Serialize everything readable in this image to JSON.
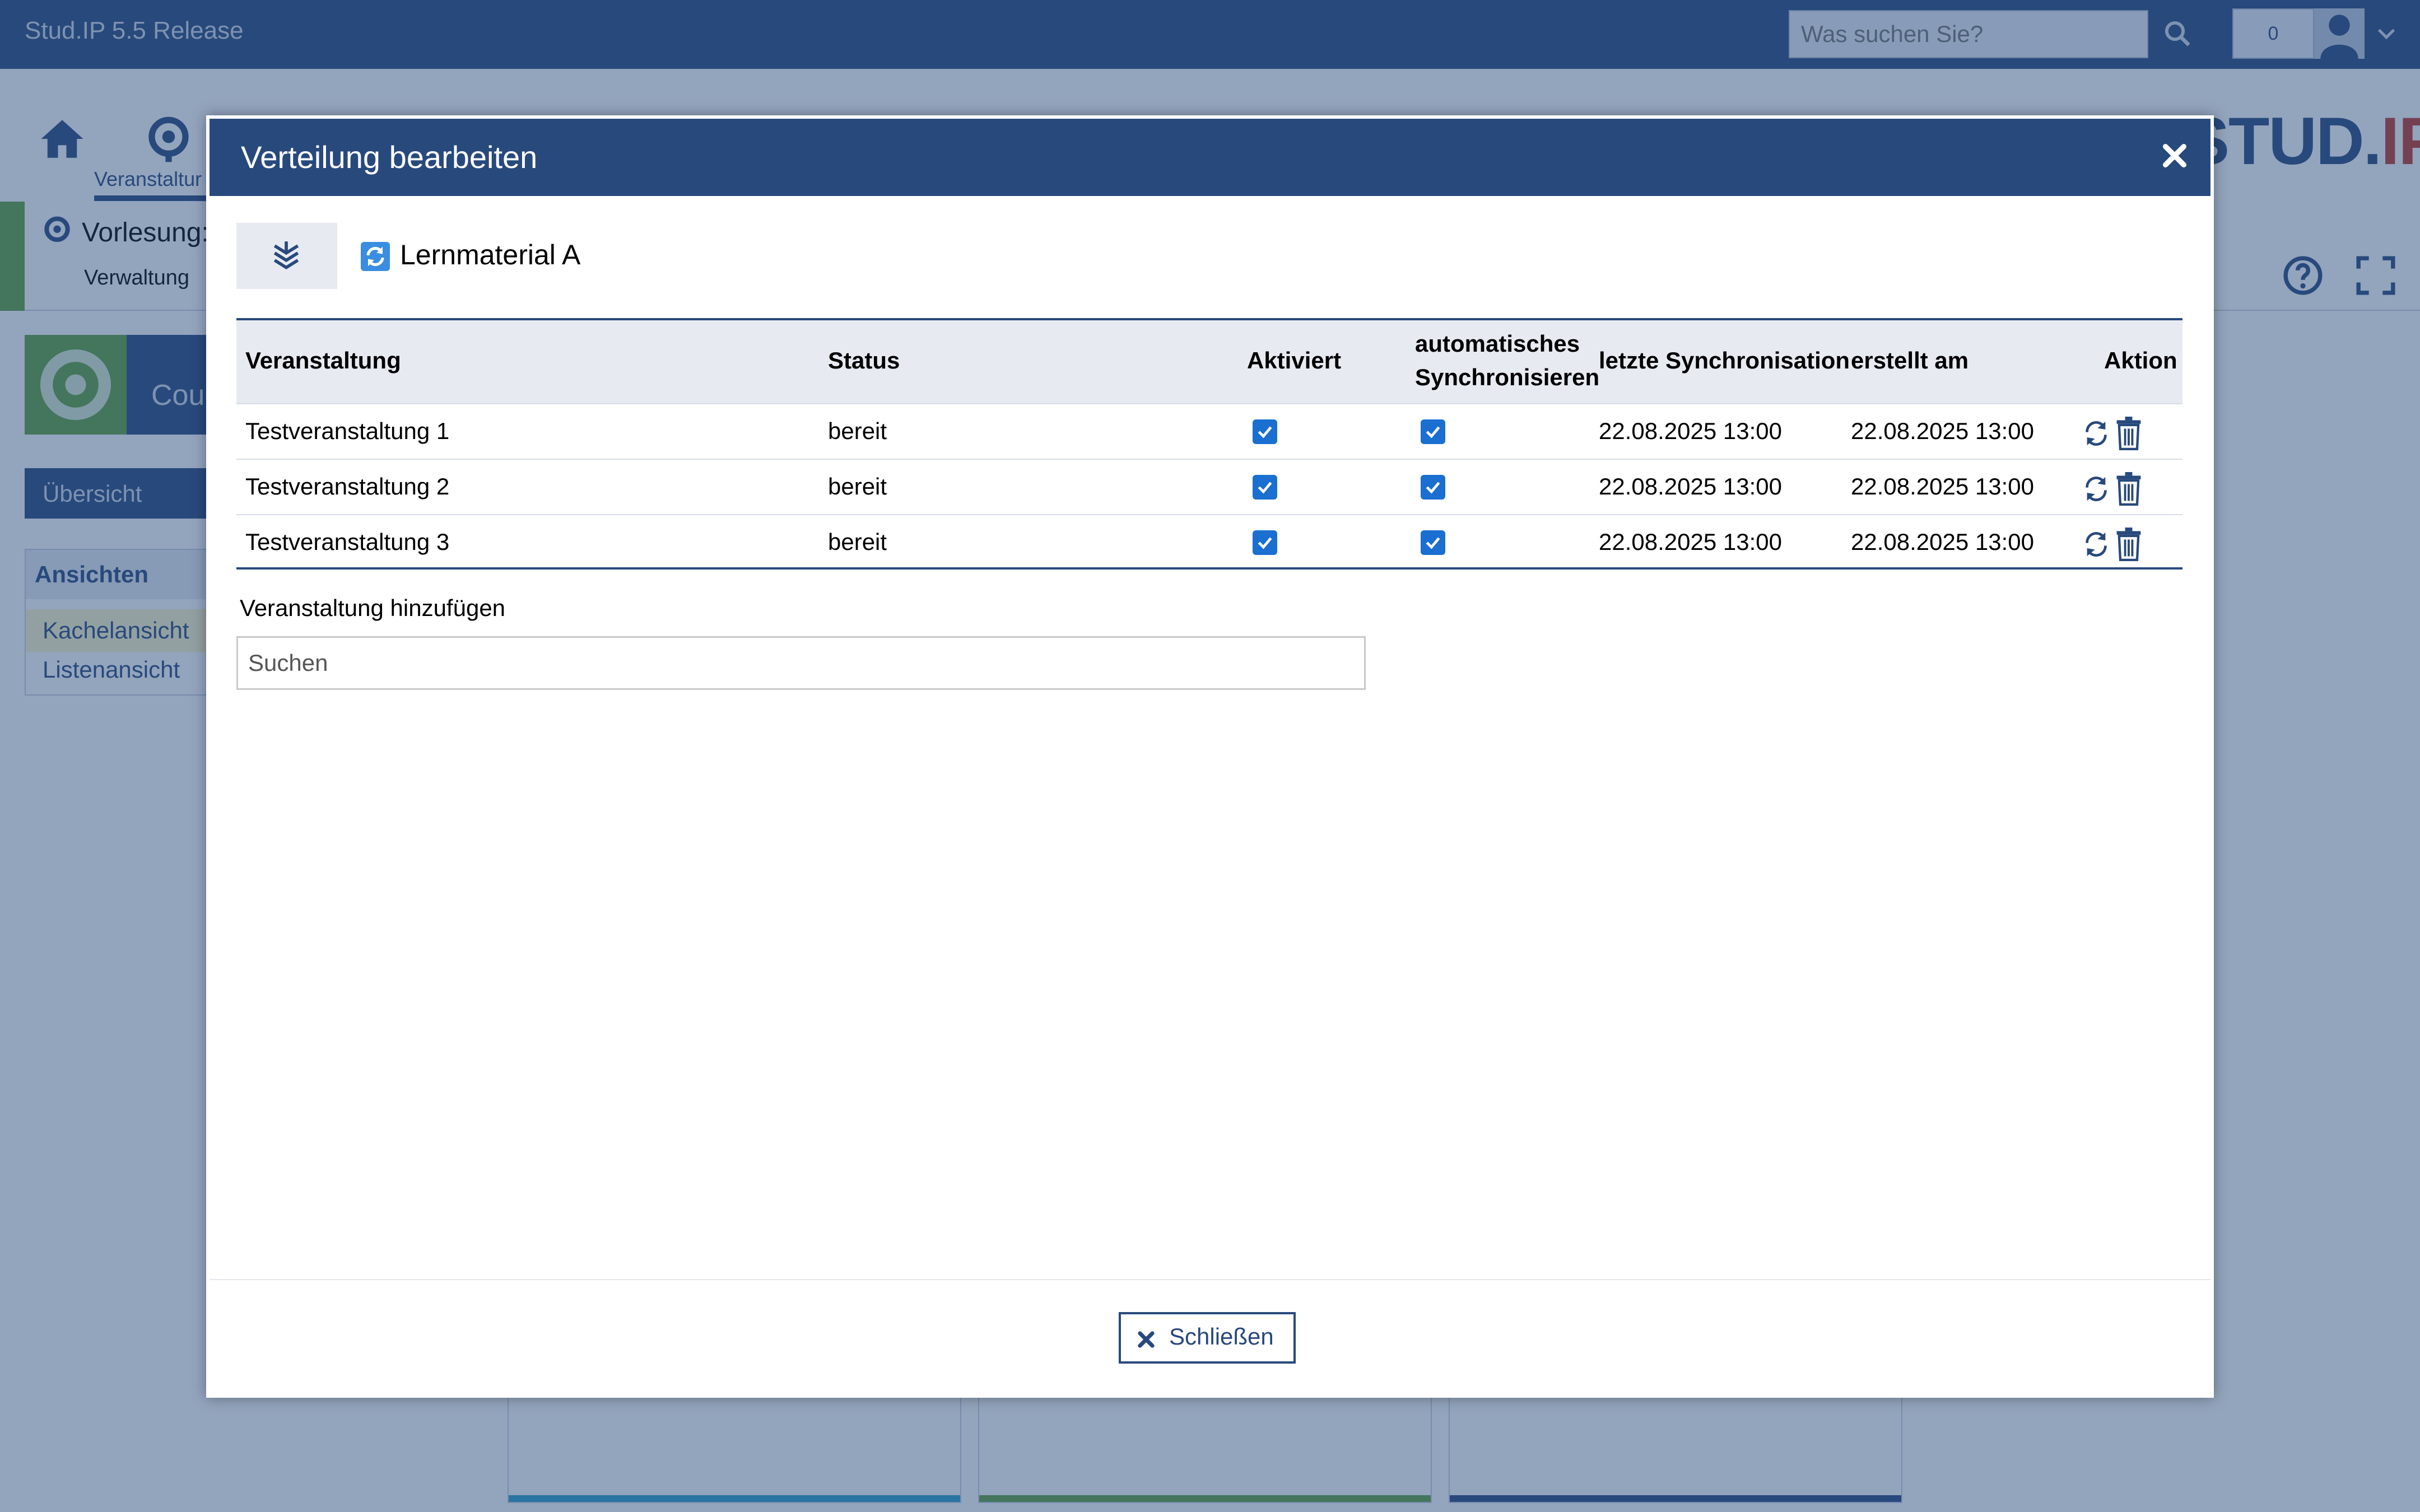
{
  "app": {
    "brand": "Stud.IP 5.5 Release",
    "search_placeholder": "Was suchen Sie?",
    "notification_count": "0",
    "logo_main": "STUD.",
    "logo_accent": "IP"
  },
  "nav": {
    "courses_label": "Veranstaltur"
  },
  "context": {
    "title": "Vorlesung:",
    "subtitle": "Verwaltung"
  },
  "sidebar": {
    "tile_text": "Cour",
    "overview": "Übersicht",
    "views_heading": "Ansichten",
    "views_items": [
      "Kachelansicht",
      "Listenansicht"
    ]
  },
  "dialog": {
    "title": "Verteilung bearbeiten",
    "material_name": "Lernmaterial A",
    "columns": {
      "course": "Veranstaltung",
      "status": "Status",
      "activated": "Aktiviert",
      "auto_sync_line1": "automatisches",
      "auto_sync_line2": "Synchronisieren",
      "last_sync": "letzte Synchronisation",
      "created": "erstellt am",
      "action": "Aktion"
    },
    "rows": [
      {
        "course": "Testveranstaltung 1",
        "status": "bereit",
        "activated": true,
        "auto_sync": true,
        "last_sync": "22.08.2025 13:00",
        "created": "22.08.2025 13:00"
      },
      {
        "course": "Testveranstaltung 2",
        "status": "bereit",
        "activated": true,
        "auto_sync": true,
        "last_sync": "22.08.2025 13:00",
        "created": "22.08.2025 13:00"
      },
      {
        "course": "Testveranstaltung 3",
        "status": "bereit",
        "activated": true,
        "auto_sync": true,
        "last_sync": "22.08.2025 13:00",
        "created": "22.08.2025 13:00"
      }
    ],
    "add_label": "Veranstaltung hinzufügen",
    "add_placeholder": "Suchen",
    "close_label": "Schließen"
  },
  "colors": {
    "primary": "#28497c",
    "accent_green": "#5fa23d",
    "checkbox_blue": "#1a6fd0",
    "header_bg": "#e7ebf1"
  }
}
